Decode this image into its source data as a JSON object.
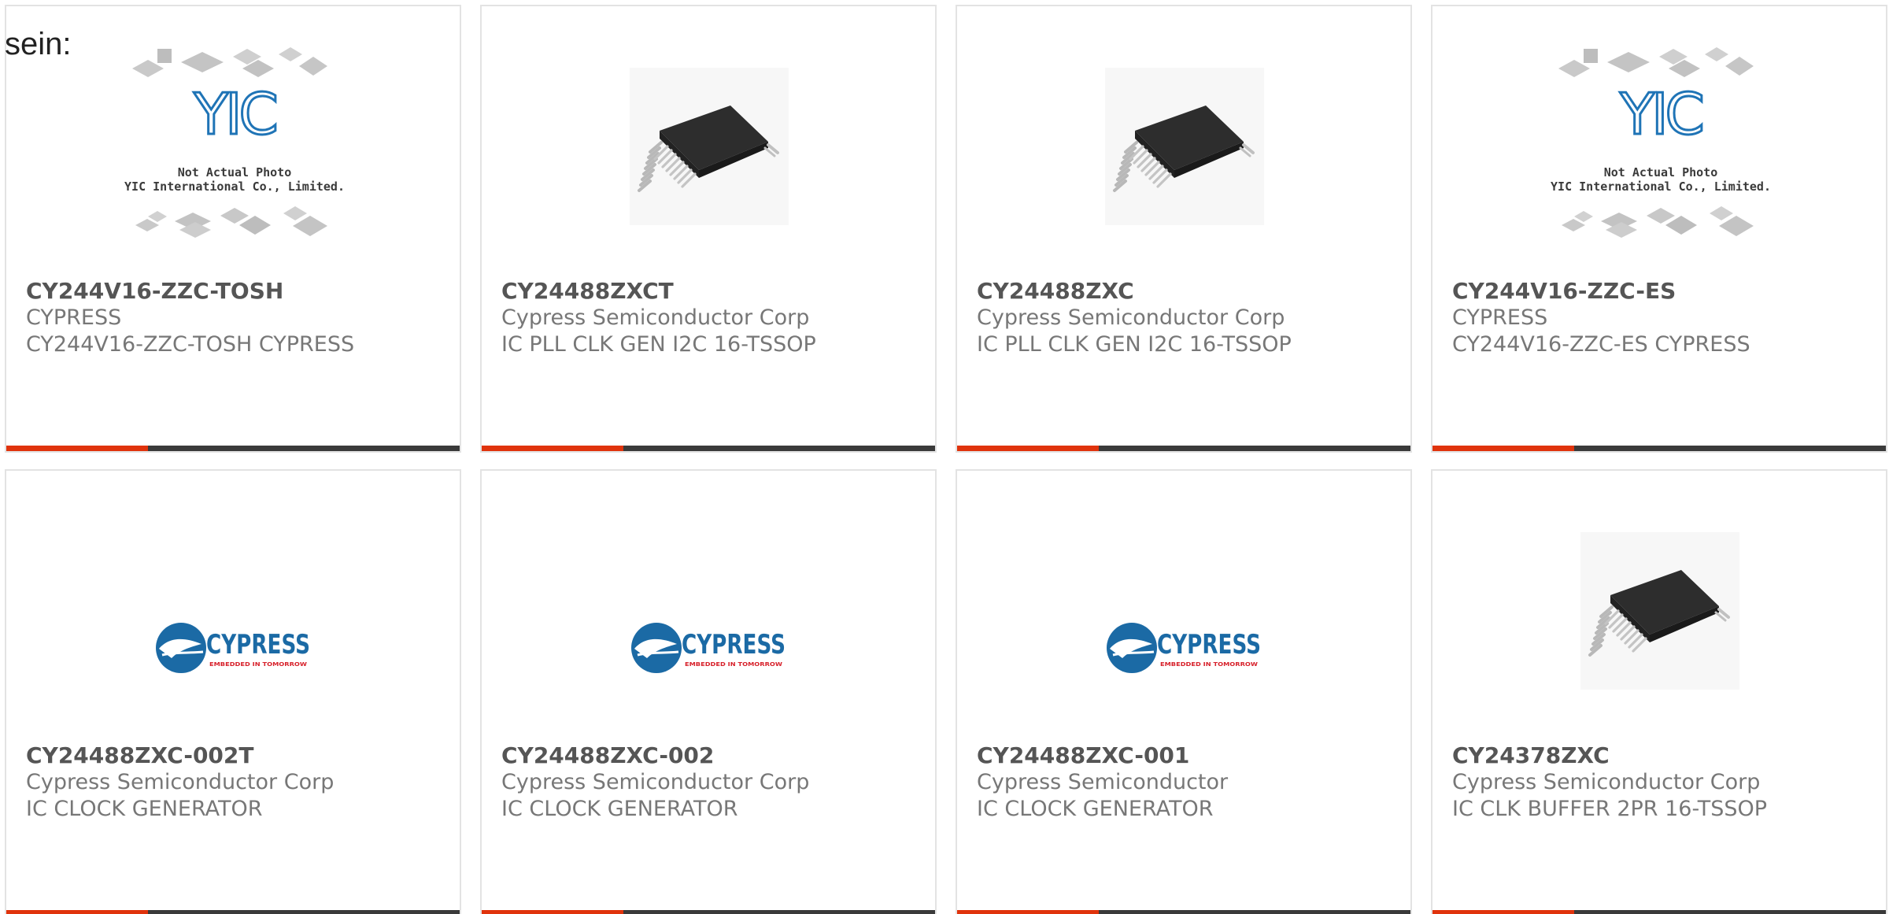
{
  "lead_text": "sein:",
  "colors": {
    "accent_bar": "#e0330c",
    "bar": "#3a3a3a",
    "border": "#e3e3e3",
    "cypress_blue": "#1b6aa5",
    "cypress_red": "#d7202a"
  },
  "placeholder": {
    "brand": "YIC",
    "line1": "Not Actual Photo",
    "line2": "YIC International Co., Limited."
  },
  "cypress_logo": {
    "name": "CYPRESS",
    "tagline": "EMBEDDED IN TOMORROW"
  },
  "products": [
    {
      "part": "CY244V16-ZZC-TOSH",
      "maker": "CYPRESS",
      "desc": "CY244V16-ZZC-TOSH CYPRESS",
      "image": "yic-placeholder"
    },
    {
      "part": "CY24488ZXCT",
      "maker": "Cypress Semiconductor Corp",
      "desc": "IC PLL CLK GEN I2C 16-TSSOP",
      "image": "chip-photo"
    },
    {
      "part": "CY24488ZXC",
      "maker": "Cypress Semiconductor Corp",
      "desc": "IC PLL CLK GEN I2C 16-TSSOP",
      "image": "chip-photo"
    },
    {
      "part": "CY244V16-ZZC-ES",
      "maker": "CYPRESS",
      "desc": "CY244V16-ZZC-ES CYPRESS",
      "image": "yic-placeholder"
    },
    {
      "part": "CY24488ZXC-002T",
      "maker": "Cypress Semiconductor Corp",
      "desc": "IC CLOCK GENERATOR",
      "image": "cypress-logo"
    },
    {
      "part": "CY24488ZXC-002",
      "maker": "Cypress Semiconductor Corp",
      "desc": "IC CLOCK GENERATOR",
      "image": "cypress-logo"
    },
    {
      "part": "CY24488ZXC-001",
      "maker": "Cypress Semiconductor",
      "desc": "IC CLOCK GENERATOR",
      "image": "cypress-logo"
    },
    {
      "part": "CY24378ZXC",
      "maker": "Cypress Semiconductor Corp",
      "desc": "IC CLK BUFFER 2PR 16-TSSOP",
      "image": "chip-photo"
    }
  ]
}
